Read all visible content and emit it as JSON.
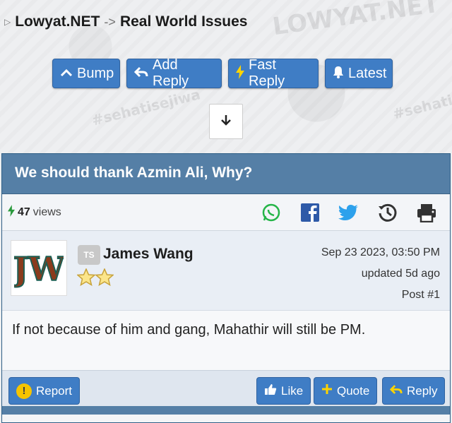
{
  "breadcrumb": {
    "site": "Lowyat.NET",
    "separator": "->",
    "forum": "Real World Issues"
  },
  "background": {
    "logo_text": "LOWYAT.NET",
    "hashtag": "#sehatisejiwa",
    "hashtag_2": "#sehatis"
  },
  "toolbar": {
    "bump_label": "Bump",
    "add_reply_label": "Add Reply",
    "fast_reply_label": "Fast Reply",
    "latest_label": "Latest"
  },
  "thread": {
    "title": "We should thank Azmin Ali, Why?",
    "views_count": "47",
    "views_label": "views"
  },
  "post": {
    "badge": "TS",
    "username": "James Wang",
    "avatar_text": "JW",
    "stars": 2,
    "date": "Sep 23 2023, 03:50 PM",
    "updated": "updated 5d ago",
    "post_number": "Post #1",
    "body": "If not because of him and gang, Mahathir will still be PM."
  },
  "actions": {
    "report_label": "Report",
    "like_label": "Like",
    "quote_label": "Quote",
    "reply_label": "Reply"
  },
  "colors": {
    "button_blue": "#3f7dc5",
    "title_bar": "#557fa6",
    "whatsapp": "#25b548",
    "facebook": "#2e5aa8",
    "twitter": "#2da1ec"
  }
}
